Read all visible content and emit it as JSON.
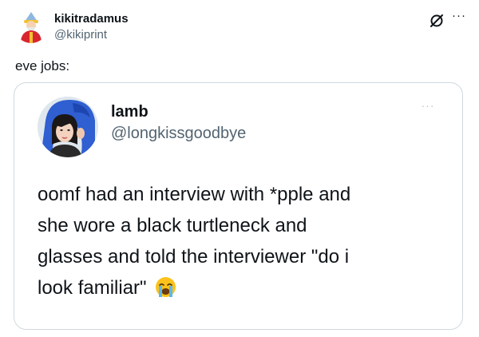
{
  "tweet": {
    "author": {
      "name": "kikitradamus",
      "handle": "@kikiprint",
      "avatar_icon": "cartoon-character-avatar"
    },
    "text": "eve jobs:",
    "more_icon": "more-dots-icon",
    "grok_icon": "grok-icon",
    "more_label": "···"
  },
  "quote": {
    "author": {
      "name": "lamb",
      "handle": "@longkissgoodbye",
      "avatar_icon": "profile-photo-avatar"
    },
    "more_label": "···",
    "lines": [
      "oomf had an interview with *pple and",
      "she wore a black turtleneck and",
      "glasses and told the interviewer \"do i",
      "look familiar\""
    ],
    "emoji_icon": "loudly-crying-face-emoji"
  },
  "colors": {
    "text": "#0f1419",
    "secondary": "#536471",
    "border": "#cfd9de"
  }
}
